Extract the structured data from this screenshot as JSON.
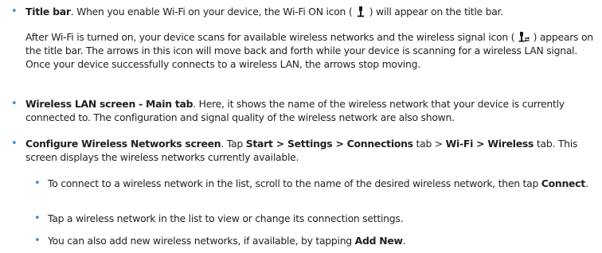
{
  "content": {
    "bullet_glyph": "•",
    "title_bar": {
      "label": "Title bar",
      "text_before_icon": ". When you enable Wi-Fi on your device, the Wi-Fi ON icon ( ",
      "icon": "wifi-on-icon",
      "text_after_icon": " ) will appear on the title bar."
    },
    "scan_paragraph": {
      "text_before_icon": "After Wi-Fi is turned on, your device scans for available wireless networks and the wireless signal icon ( ",
      "icon": "wireless-signal-icon",
      "text_after_icon": " ) appears on the title bar. The arrows in this icon will move back and forth while your device is scanning for a wireless LAN signal. Once your device successfully connects to a wireless LAN, the arrows stop moving."
    },
    "wireless_lan": {
      "label": "Wireless LAN screen - Main tab",
      "text": ". Here, it shows the name of the wireless network that your device is currently connected to. The configuration and signal quality of the wireless network are also shown."
    },
    "configure": {
      "label": "Configure Wireless Networks screen",
      "text_1": ". Tap ",
      "path_1": "Start > Settings > Connections",
      "text_2": " tab > ",
      "path_2": "Wi-Fi > Wireless",
      "text_3": " tab. This screen displays the wireless networks currently available."
    },
    "sub_items": {
      "connect": {
        "text_before": "To connect to a wireless network in the list, scroll to the name of the desired wireless network, then tap ",
        "bold": "Connect",
        "text_after": "."
      },
      "tap_network": {
        "text": "Tap a wireless network in the list to view or change its connection settings."
      },
      "add_new": {
        "text_before": "You can also add new wireless networks, if available, by tapping ",
        "bold": "Add New",
        "text_after": "."
      }
    }
  }
}
